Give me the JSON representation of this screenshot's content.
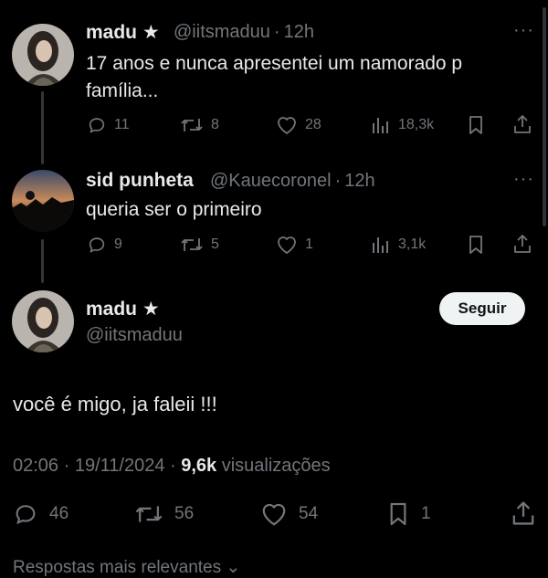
{
  "tweet1": {
    "display_name": "madu ★",
    "handle": "@iitsmaduu",
    "sep": "·",
    "time": "12h",
    "text_line1": "17 anos e nunca apresentei um namorado p",
    "text_line2": "família...",
    "replies": "11",
    "retweets": "8",
    "likes": "28",
    "views": "18,3k",
    "more": "···"
  },
  "tweet2": {
    "display_name": "sid punheta",
    "handle": "@Kauecoronel",
    "sep": "·",
    "time": "12h",
    "text": "queria ser o primeiro",
    "replies": "9",
    "retweets": "5",
    "likes": "1",
    "views": "3,1k",
    "more": "···"
  },
  "main": {
    "display_name": "madu ★",
    "handle": "@iitsmaduu",
    "follow_label": "Seguir",
    "text": "você é migo, ja faleii !!!",
    "timestamp": "02:06 · 19/11/2024 · ",
    "views_count": "9,6k",
    "views_label": " visualizações",
    "replies": "46",
    "retweets": "56",
    "likes": "54",
    "bookmarks": "1"
  },
  "footer": {
    "partial_text": "Respostas mais relevantes ⌄"
  },
  "colors": {
    "background": "#000000",
    "text": "#e7e9ea",
    "muted": "#71767b",
    "follow_bg": "#eff3f4"
  }
}
